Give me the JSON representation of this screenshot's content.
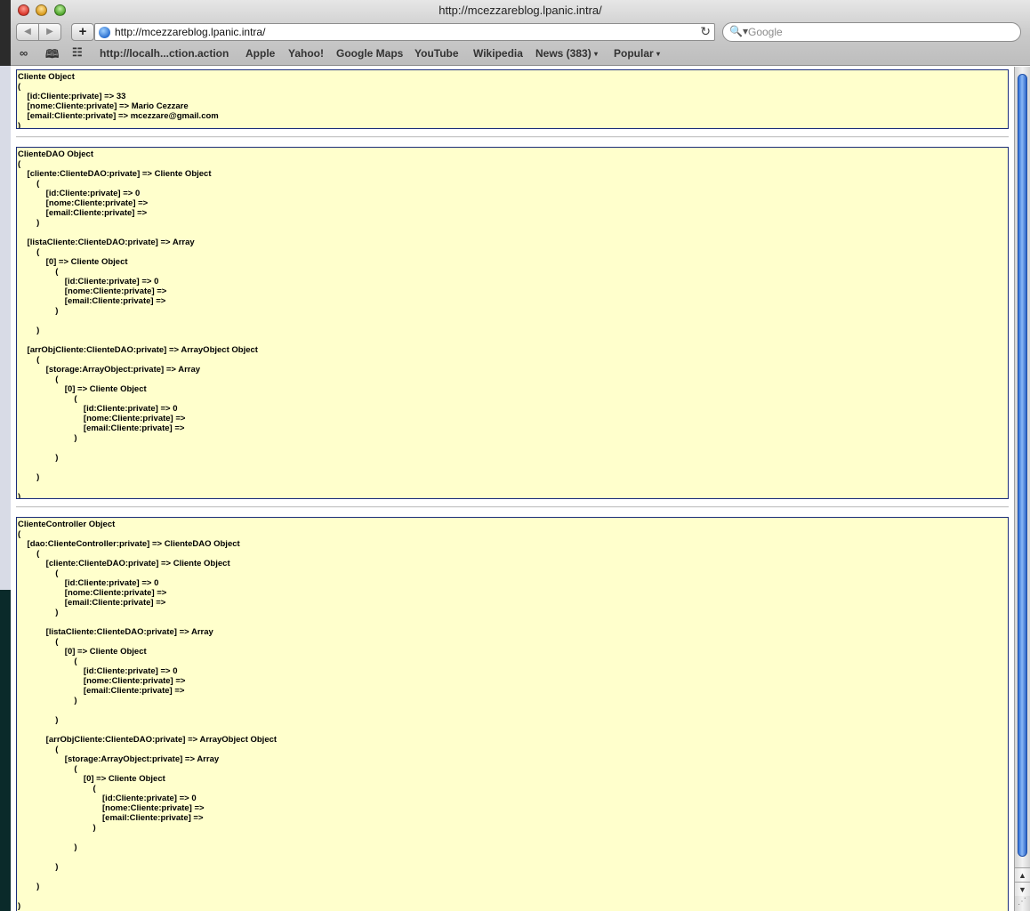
{
  "window": {
    "title": "http://mcezzareblog.lpanic.intra/"
  },
  "toolbar": {
    "back_glyph": "◀",
    "forward_glyph": "▶",
    "add_glyph": "+",
    "address_value": "http://mcezzareblog.lpanic.intra/",
    "reload_glyph": "↻",
    "search_placeholder": "Google",
    "search_glyph": "🔍▾"
  },
  "bookmarks": {
    "icons": [
      "reading-list-icon",
      "bookmarks-book-icon",
      "top-sites-grid-icon"
    ],
    "items": [
      {
        "label": "http://localh...ction.action"
      },
      {
        "label": "Apple"
      },
      {
        "label": "Yahoo!"
      },
      {
        "label": "Google Maps"
      },
      {
        "label": "YouTube"
      },
      {
        "label": "Wikipedia"
      },
      {
        "label": "News (383)",
        "menu": "▾"
      },
      {
        "label": "Popular",
        "menu": "▾"
      }
    ]
  },
  "content": {
    "cliente_dump": "Cliente Object\n(\n    [id:Cliente:private] => 33\n    [nome:Cliente:private] => Mario Cezzare\n    [email:Cliente:private] => mcezzare@gmail.com\n)",
    "clientedao_dump": "ClienteDAO Object\n(\n    [cliente:ClienteDAO:private] => Cliente Object\n        (\n            [id:Cliente:private] => 0\n            [nome:Cliente:private] => \n            [email:Cliente:private] => \n        )\n\n    [listaCliente:ClienteDAO:private] => Array\n        (\n            [0] => Cliente Object\n                (\n                    [id:Cliente:private] => 0\n                    [nome:Cliente:private] => \n                    [email:Cliente:private] => \n                )\n\n        )\n\n    [arrObjCliente:ClienteDAO:private] => ArrayObject Object\n        (\n            [storage:ArrayObject:private] => Array\n                (\n                    [0] => Cliente Object\n                        (\n                            [id:Cliente:private] => 0\n                            [nome:Cliente:private] => \n                            [email:Cliente:private] => \n                        )\n\n                )\n\n        )\n\n)",
    "clientecontroller_dump": "ClienteController Object\n(\n    [dao:ClienteController:private] => ClienteDAO Object\n        (\n            [cliente:ClienteDAO:private] => Cliente Object\n                (\n                    [id:Cliente:private] => 0\n                    [nome:Cliente:private] => \n                    [email:Cliente:private] => \n                )\n\n            [listaCliente:ClienteDAO:private] => Array\n                (\n                    [0] => Cliente Object\n                        (\n                            [id:Cliente:private] => 0\n                            [nome:Cliente:private] => \n                            [email:Cliente:private] => \n                        )\n\n                )\n\n            [arrObjCliente:ClienteDAO:private] => ArrayObject Object\n                (\n                    [storage:ArrayObject:private] => Array\n                        (\n                            [0] => Cliente Object\n                                (\n                                    [id:Cliente:private] => 0\n                                    [nome:Cliente:private] => \n                                    [email:Cliente:private] => \n                                )\n\n                        )\n\n                )\n\n        )\n\n)"
  },
  "scrollbar": {
    "up_glyph": "▲",
    "down_glyph": "▼",
    "grip_glyph": "⋰"
  },
  "colors": {
    "dump_background": "#ffffcc",
    "dump_border": "#1a2d7a",
    "scroll_thumb": "#2e6fd9"
  }
}
